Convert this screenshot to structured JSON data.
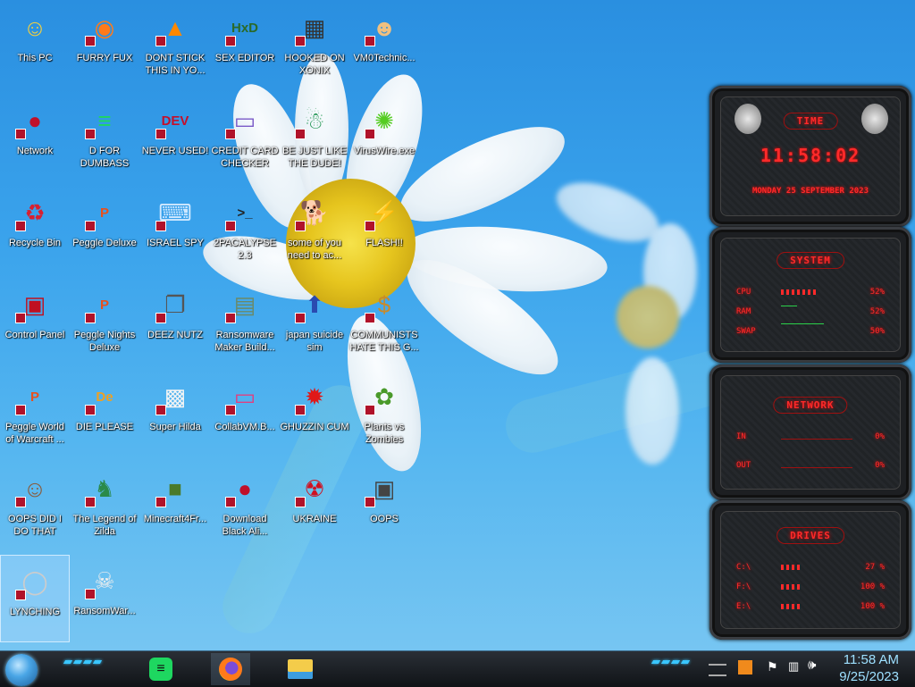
{
  "desktop": {
    "icons": [
      {
        "label": "This PC",
        "icon": "cartoon-face-icon"
      },
      {
        "label": "FURRY FUX",
        "icon": "firefox-icon"
      },
      {
        "label": "DONT STICK THIS IN YO...",
        "icon": "vlc-cone-icon"
      },
      {
        "label": "SEX EDITOR",
        "icon": "hxd-icon"
      },
      {
        "label": "HOOKED ON XONIX",
        "icon": "maze-icon"
      },
      {
        "label": "VM0Technic...",
        "icon": "technician-icon"
      },
      {
        "label": "Network",
        "icon": "alien-orb-icon"
      },
      {
        "label": "D FOR DUMBASS",
        "icon": "spotify-icon"
      },
      {
        "label": "NEVER USED!",
        "icon": "dev-cpp-icon"
      },
      {
        "label": "CREDIT CARD CHECKER",
        "icon": "credit-card-icon"
      },
      {
        "label": "BE JUST LIKE THE DUDE!",
        "icon": "elf-icon"
      },
      {
        "label": "VirusWire.exe",
        "icon": "lime-icon"
      },
      {
        "label": "Recycle Bin",
        "icon": "recycle-bin-icon"
      },
      {
        "label": "Peggle Deluxe",
        "icon": "peggle-icon"
      },
      {
        "label": "ISRAEL SPY",
        "icon": "network-computer-icon"
      },
      {
        "label": "2PACALYPSE 2.3",
        "icon": "terminal-icon"
      },
      {
        "label": "some of you need to ac...",
        "icon": "dog-icon"
      },
      {
        "label": "FLASH!!",
        "icon": "flash-icon"
      },
      {
        "label": "Control Panel",
        "icon": "control-panel-icon"
      },
      {
        "label": "Peggle Nights Deluxe",
        "icon": "peggle-icon"
      },
      {
        "label": "DEEZ NUTZ",
        "icon": "windows-stack-icon"
      },
      {
        "label": "Ransomware Maker Build...",
        "icon": "window-app-icon"
      },
      {
        "label": "japan suicide sim",
        "icon": "japan-sim-icon"
      },
      {
        "label": "COMMUNISTS HATE THIS G...",
        "icon": "money-bag-icon"
      },
      {
        "label": "Peggle World of Warcraft ...",
        "icon": "peggle-icon"
      },
      {
        "label": "DIE PLEASE",
        "icon": "de-icon"
      },
      {
        "label": "Super Hilda",
        "icon": "pixel-cat-icon"
      },
      {
        "label": "CollabVM.B...",
        "icon": "monitor-icon"
      },
      {
        "label": "GHUZZIN CUM",
        "icon": "red-fuzzball-icon"
      },
      {
        "label": "Plants vs Zombies",
        "icon": "plant-icon"
      },
      {
        "label": "OOPS DID I DO THAT",
        "icon": "portrait-icon"
      },
      {
        "label": "The Legend of Zilda",
        "icon": "pixel-hero-icon"
      },
      {
        "label": "Minecraft4Fr...",
        "icon": "minecraft-block-icon"
      },
      {
        "label": "Download Black Ali...",
        "icon": "alien-orb-icon"
      },
      {
        "label": "UKRAINE",
        "icon": "radiation-icon"
      },
      {
        "label": "OOPS",
        "icon": "screen-icon"
      },
      {
        "label": "LYNCHING",
        "icon": "noose-icon"
      },
      {
        "label": "RansomWar...",
        "icon": "skull-icon"
      }
    ]
  },
  "gadgets": {
    "time": {
      "title": "TIME",
      "clock": "11:58:02",
      "date": "MONDAY 25 SEPTEMBER 2023"
    },
    "system": {
      "title": "SYSTEM",
      "rows": [
        {
          "key": "CPU",
          "value": "52%",
          "level": 0.52
        },
        {
          "key": "RAM",
          "value": "52%",
          "level": 0.52
        },
        {
          "key": "SWAP",
          "value": "50%",
          "level": 0.5
        }
      ]
    },
    "network": {
      "title": "NETWORK",
      "rows": [
        {
          "key": "IN",
          "value": "0%"
        },
        {
          "key": "OUT",
          "value": "0%"
        }
      ]
    },
    "drives": {
      "title": "DRIVES",
      "rows": [
        {
          "key": "C:\\",
          "value": "27 %",
          "level": 0.27
        },
        {
          "key": "F:\\",
          "value": "100 %",
          "level": 1.0
        },
        {
          "key": "E:\\",
          "value": "100 %",
          "level": 1.0
        }
      ]
    }
  },
  "taskbar": {
    "pinned": [
      "spotify-icon",
      "firefox-icon",
      "file-explorer-icon"
    ],
    "time": "11:58 AM",
    "date": "9/25/2023"
  },
  "colors": {
    "accent": "#ff2a2a",
    "taskbar_glow": "#3ac6ff"
  }
}
